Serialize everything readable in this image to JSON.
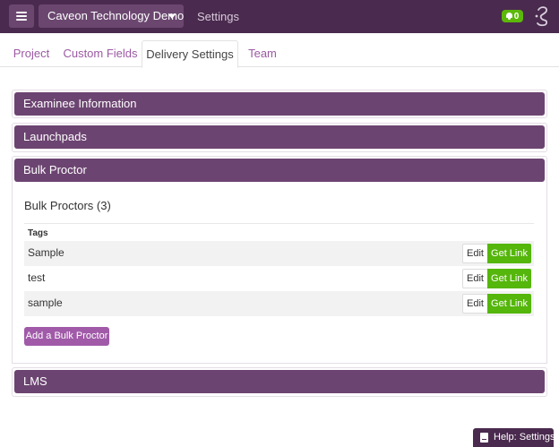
{
  "header": {
    "org_name": "Caveon Technology Demo",
    "settings_label": "Settings",
    "notification_count": "0"
  },
  "tabs": [
    {
      "label": "Project"
    },
    {
      "label": "Custom Fields"
    },
    {
      "label": "Delivery Settings",
      "active": true
    },
    {
      "label": "Team"
    }
  ],
  "panels": {
    "examinee": "Examinee Information",
    "launchpads": "Launchpads",
    "bulk_proctor": "Bulk Proctor",
    "lms": "LMS"
  },
  "bulk_proctor": {
    "title": "Bulk Proctors (3)",
    "column_tags": "Tags",
    "rows": [
      {
        "name": "Sample",
        "edit": "Edit",
        "get_link": "Get Link"
      },
      {
        "name": "test",
        "edit": "Edit",
        "get_link": "Get Link"
      },
      {
        "name": "sample",
        "edit": "Edit",
        "get_link": "Get Link"
      }
    ],
    "add_label": "Add a Bulk Proctor"
  },
  "help": {
    "label": "Help: Settings"
  },
  "colors": {
    "topbar": "#4a2a4e",
    "panel_header": "#6c4471",
    "accent": "#9b59a3",
    "success": "#55b60b"
  }
}
